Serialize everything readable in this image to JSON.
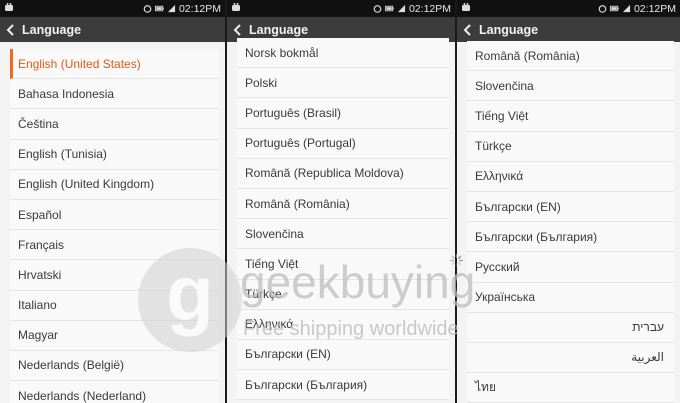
{
  "status": {
    "time": "02:12PM"
  },
  "header": {
    "title": "Language"
  },
  "panel1": {
    "items": [
      "English (United States)",
      "Bahasa Indonesia",
      "Čeština",
      "English (Tunisia)",
      "English (United Kingdom)",
      "Español",
      "Français",
      "Hrvatski",
      "Italiano",
      "Magyar",
      "Nederlands (België)",
      "Nederlands (Nederland)"
    ],
    "selected_index": 0
  },
  "panel2": {
    "items": [
      "Norsk bokmål",
      "Polski",
      "Português (Brasil)",
      "Português (Portugal)",
      "Română (Republica Moldova)",
      "Română (România)",
      "Slovenčina",
      "Tiếng Việt",
      "Türkçe",
      "Ελληνικά",
      "Български (EN)",
      "Български (България)"
    ]
  },
  "panel3": {
    "items": [
      "Română (România)",
      "Slovenčina",
      "Tiếng Việt",
      "Türkçe",
      "Ελληνικά",
      "Български (EN)",
      "Български (България)",
      "Русский",
      "Українська",
      "עברית",
      "العربية",
      "ไทย"
    ]
  },
  "watermark": {
    "brand": "geekbuying",
    "tagline": "Free shipping worldwide"
  },
  "colors": {
    "accent": "#f26a1b",
    "header_bg": "#3c3c3c",
    "status_bg": "#111111"
  }
}
